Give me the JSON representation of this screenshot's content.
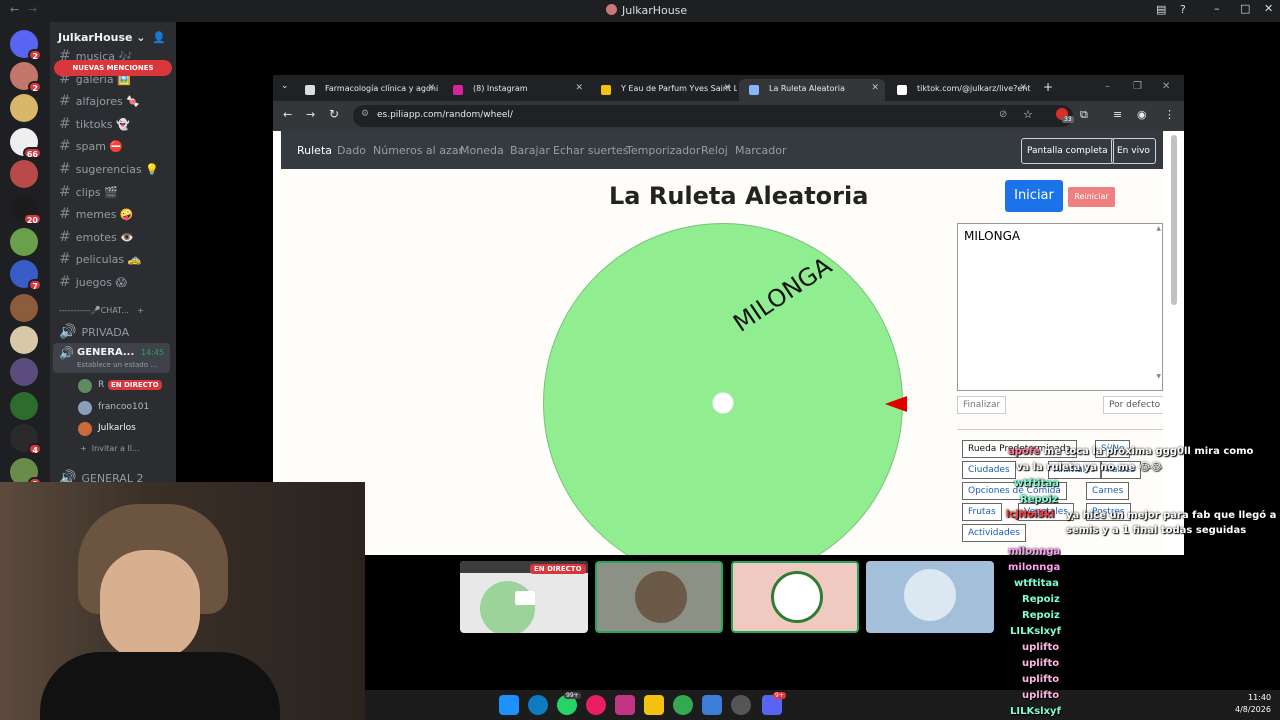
{
  "window_title": "JulkarHouse",
  "discord": {
    "server_name": "JulkarHouse",
    "mentions_banner": "NUEVAS MENCIONES",
    "servers": [
      {
        "badge": "2",
        "color": "#5865f2"
      },
      {
        "badge": "2",
        "color": "#c2776a"
      },
      {
        "badge": "",
        "color": "#d8b66a"
      },
      {
        "badge": "66",
        "color": "#eeeeee"
      },
      {
        "badge": "",
        "color": "#b84a4a"
      },
      {
        "badge": "20",
        "color": "#1c1c1c"
      },
      {
        "badge": "",
        "color": "#6aa04c"
      },
      {
        "badge": "7",
        "color": "#3a5cc8"
      },
      {
        "badge": "",
        "color": "#8c5c3c"
      },
      {
        "badge": "",
        "color": "#d8c8a8"
      },
      {
        "badge": "",
        "color": "#5a4c7c"
      },
      {
        "badge": "",
        "color": "#2c6c2c"
      },
      {
        "badge": "4",
        "color": "#2a2a2a"
      },
      {
        "badge": "9",
        "color": "#6a8c4a"
      }
    ],
    "channels": [
      {
        "name": "musica 🎶"
      },
      {
        "name": "galeria 🖼️"
      },
      {
        "name": "alfajores 🍬"
      },
      {
        "name": "tiktoks 👻"
      },
      {
        "name": "spam ⛔"
      },
      {
        "name": "sugerencias 💡"
      },
      {
        "name": "clips 🎬"
      },
      {
        "name": "memes 🤪"
      },
      {
        "name": "emotes 👁️"
      },
      {
        "name": "peliculas 🚕"
      },
      {
        "name": "juegos 😱"
      }
    ],
    "category": "-----------🎤CHAT...",
    "voice_private": "PRIVADA",
    "voice_general": "GENERA...",
    "voice_time": "14:45",
    "voice_status": "Establece un estado ...",
    "users": [
      {
        "name": "R",
        "live": "EN DIRECTO"
      },
      {
        "name": "francoo101",
        "live": ""
      },
      {
        "name": "Julkarlos",
        "live": ""
      }
    ],
    "invite": "Invitar a ll...",
    "voice_general2": "GENERAL 2"
  },
  "browser": {
    "tabs": [
      {
        "label": "Farmacología clínica y agoni",
        "icon_color": "#dadce0"
      },
      {
        "label": "(8) Instagram",
        "icon_color": "#d6249f"
      },
      {
        "label": "Y Eau de Parfum Yves Saint L",
        "icon_color": "#f4c20d"
      },
      {
        "label": "La Ruleta Aleatoria",
        "icon_color": "#8ab4f8"
      },
      {
        "label": "tiktok.com/@julkarz/live?ent",
        "icon_color": "#ffffff"
      }
    ],
    "url": "es.piliapp.com/random/wheel/",
    "ext_badge": "33"
  },
  "app": {
    "nav": [
      "Ruleta",
      "Dado",
      "Números al azar",
      "Moneda",
      "Barajar",
      "Echar suertes",
      "Temporizador",
      "Reloj",
      "Marcador"
    ],
    "fullscreen": "Pantalla completa",
    "live": "En vivo",
    "title": "La Ruleta Aleatoria",
    "start": "Iniciar",
    "reset": "Reiniciar",
    "wheel_label": "MILONGA",
    "choices_text": "MILONGA",
    "finish": "Finalizar",
    "default": "Por defecto",
    "presets": [
      "Rueda Predeterminada",
      "Sí/No",
      "Ciudades",
      "Animales",
      "Países",
      "Opciones de Comida",
      "Carnes",
      "Frutas",
      "Vegetales",
      "Postres",
      "Actividades"
    ],
    "colors": {
      "wheel": "#90ee90",
      "start": "#1a73e8",
      "reset": "#f08080",
      "pointer": "#e00000"
    }
  },
  "stage": {
    "live": "EN DIRECTO"
  },
  "chat": [
    {
      "user": "apofe",
      "msg": "me toca la proxima ggg0ll mira como",
      "color": "#ff7f9f"
    },
    {
      "user": "",
      "msg": "va la ruleta ya no me 😂😂",
      "color": "#ffffff"
    },
    {
      "user": "wtftitaa",
      "msg": "",
      "color": "#7fffd4"
    },
    {
      "user": "Repoiz",
      "msg": "",
      "color": "#7fffd4"
    },
    {
      "user": "lcjNoi3ki",
      "msg": "",
      "color": "#ff4040"
    },
    {
      "user": "",
      "msg": "ya hice un mejor para fab que llegó a 2",
      "color": "#ffffff"
    },
    {
      "user": "",
      "msg": "semis y a 1 final todas seguidas",
      "color": "#ffffff"
    },
    {
      "user": "milonnga",
      "msg": "",
      "color": "#ff9ff3"
    },
    {
      "user": "milonnga",
      "msg": "",
      "color": "#ff9ff3"
    },
    {
      "user": "wtftitaa",
      "msg": "",
      "color": "#7fffd4"
    },
    {
      "user": "Repoiz",
      "msg": "",
      "color": "#7fffd4"
    },
    {
      "user": "Repoiz",
      "msg": "",
      "color": "#7fffd4"
    },
    {
      "user": "LILKslxyf",
      "msg": "",
      "color": "#7fffd4"
    },
    {
      "user": "uplifto",
      "msg": "",
      "color": "#ffb6e1"
    },
    {
      "user": "uplifto",
      "msg": "",
      "color": "#ffb6e1"
    },
    {
      "user": "uplifto",
      "msg": "",
      "color": "#ffb6e1"
    },
    {
      "user": "uplifto",
      "msg": "",
      "color": "#ffb6e1"
    },
    {
      "user": "LILKslxyf",
      "msg": "",
      "color": "#7fffd4"
    }
  ],
  "clock": {
    "time": "11:40",
    "date": "4/8/2026"
  },
  "taskbar_badges": {
    "whatsapp": "99+",
    "discord": "9+"
  }
}
